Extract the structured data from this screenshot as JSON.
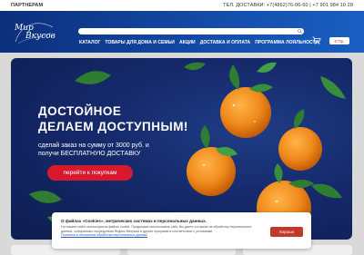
{
  "topbar": {
    "partners": "ПАРТНЕРАМ",
    "delivery_phones": "ТЕЛ. ДОСТАВКИ: +7(4862)76-06-60  |  +7 901 984 10 28"
  },
  "logo": {
    "line1": "Мир",
    "line2": "Вкусов"
  },
  "search": {
    "placeholder": ""
  },
  "nav": {
    "items": [
      "КАТАЛОГ",
      "ТОВАРЫ ДЛЯ ДОМА И СЕМЬИ",
      "АКЦИИ",
      "ДОСТАВКА И ОПЛАТА",
      "ПРОГРАММА ЛОЯЛЬНОСТИ"
    ]
  },
  "cart": {
    "total": "0 Пр."
  },
  "hero": {
    "title_line1": "ДОСТОЙНОЕ",
    "title_line2": "ДЕЛАЕМ ДОСТУПНЫМ!",
    "sub_line1": "сделай заказ на сумму от 3000 руб. и",
    "sub_line2": "получи БЕСПЛАТНУЮ ДОСТАВКУ",
    "button": "перейти к покупкам"
  },
  "cookie": {
    "title": "О файлах «Cookies», метрических системах и персональных данных.",
    "text": "На нашем сайте используются файлы cookie. Продолжая использовать сайт, Вы даете согласие на обработку персональных данных, собираемых посредством Яндекс Метрики и другие программ в соответствии с условиями",
    "link": "Политики в отношении обработки персональных данных",
    "accept": "Хорошо"
  },
  "colors": {
    "header": "#134aa6",
    "accent": "#d7192e",
    "hero_bg": "#15296a",
    "orange": "#f08a1c"
  }
}
